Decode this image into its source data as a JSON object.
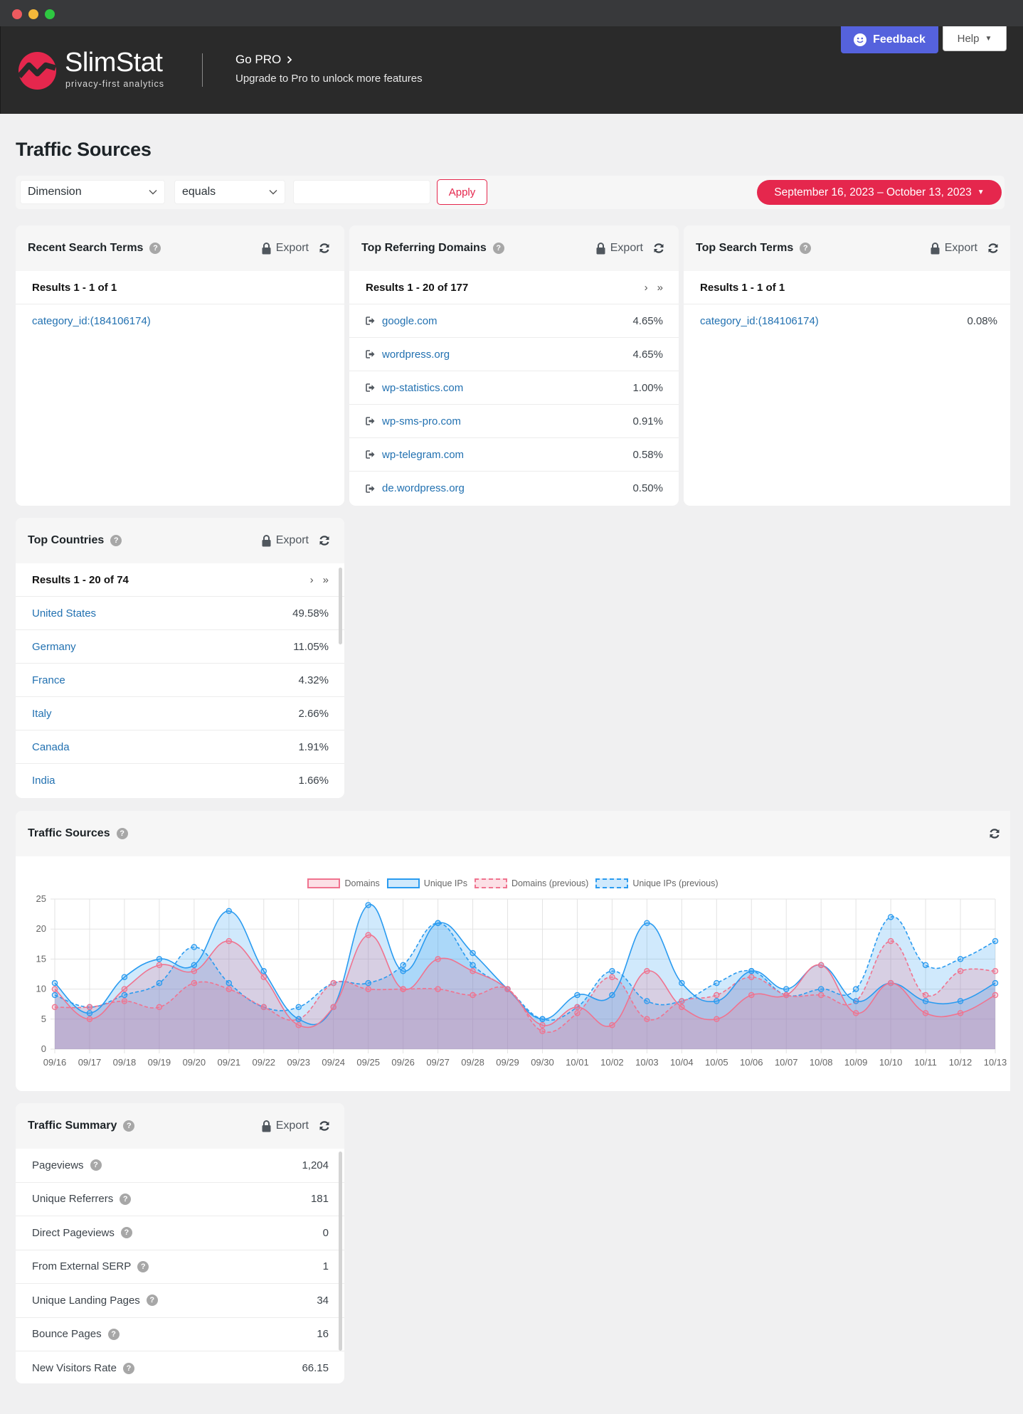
{
  "window": {
    "controls": [
      "close",
      "minimize",
      "maximize"
    ]
  },
  "header": {
    "logo_name": "SlimStat",
    "logo_tagline": "privacy-first analytics",
    "gopro_title": "Go PRO",
    "gopro_subtitle": "Upgrade to Pro to unlock more features",
    "feedback_label": "Feedback",
    "help_label": "Help"
  },
  "page": {
    "title": "Traffic Sources"
  },
  "filters": {
    "dimension": "Dimension",
    "operator": "equals",
    "value": "",
    "value_placeholder": "",
    "apply_label": "Apply",
    "date_range": "September 16, 2023 – October 13, 2023"
  },
  "common": {
    "export_label": "Export",
    "help_mark": "?",
    "next": "›",
    "last": "»"
  },
  "panels": {
    "recent_search": {
      "title": "Recent Search Terms",
      "results": "Results 1 - 1 of 1",
      "rows": [
        {
          "label": "category_id:(184106174)"
        }
      ]
    },
    "ref_domains": {
      "title": "Top Referring Domains",
      "results": "Results 1 - 20 of 177",
      "rows": [
        {
          "label": "google.com",
          "value": "4.65%"
        },
        {
          "label": "wordpress.org",
          "value": "4.65%"
        },
        {
          "label": "wp-statistics.com",
          "value": "1.00%"
        },
        {
          "label": "wp-sms-pro.com",
          "value": "0.91%"
        },
        {
          "label": "wp-telegram.com",
          "value": "0.58%"
        },
        {
          "label": "de.wordpress.org",
          "value": "0.50%"
        }
      ]
    },
    "top_search": {
      "title": "Top Search Terms",
      "results": "Results 1 - 1 of 1",
      "rows": [
        {
          "label": "category_id:(184106174)",
          "value": "0.08%"
        }
      ]
    },
    "countries": {
      "title": "Top Countries",
      "results": "Results 1 - 20 of 74",
      "rows": [
        {
          "label": "United States",
          "value": "49.58%"
        },
        {
          "label": "Germany",
          "value": "11.05%"
        },
        {
          "label": "France",
          "value": "4.32%"
        },
        {
          "label": "Italy",
          "value": "2.66%"
        },
        {
          "label": "Canada",
          "value": "1.91%"
        },
        {
          "label": "India",
          "value": "1.66%"
        }
      ]
    },
    "chart": {
      "title": "Traffic Sources"
    },
    "summary": {
      "title": "Traffic Summary",
      "rows": [
        {
          "label": "Pageviews",
          "value": "1,204"
        },
        {
          "label": "Unique Referrers",
          "value": "181"
        },
        {
          "label": "Direct Pageviews",
          "value": "0"
        },
        {
          "label": "From External SERP",
          "value": "1"
        },
        {
          "label": "Unique Landing Pages",
          "value": "34"
        },
        {
          "label": "Bounce Pages",
          "value": "16"
        },
        {
          "label": "New Visitors Rate",
          "value": "66.15"
        }
      ]
    }
  },
  "colors": {
    "brand": "#e5274d",
    "feedback": "#5562dd",
    "link": "#2271b1",
    "domains": "#f0738f",
    "unique_ips": "#2a9bf0"
  },
  "chart_data": {
    "type": "area",
    "title": "Traffic Sources",
    "xlabel": "",
    "ylabel": "",
    "ylim": [
      0,
      25
    ],
    "yticks": [
      0,
      5,
      10,
      15,
      20,
      25
    ],
    "grid": true,
    "legend": "top-center",
    "categories": [
      "09/16",
      "09/17",
      "09/18",
      "09/19",
      "09/20",
      "09/21",
      "09/22",
      "09/23",
      "09/24",
      "09/25",
      "09/26",
      "09/27",
      "09/28",
      "09/29",
      "09/30",
      "10/01",
      "10/02",
      "10/03",
      "10/04",
      "10/05",
      "10/06",
      "10/07",
      "10/08",
      "10/09",
      "10/10",
      "10/11",
      "10/12",
      "10/13"
    ],
    "series": [
      {
        "name": "Domains",
        "style": "solid",
        "color": "#f0738f",
        "values": [
          10,
          5,
          10,
          14,
          13,
          18,
          12,
          4,
          7,
          19,
          10,
          15,
          13,
          10,
          4,
          7,
          4,
          13,
          7,
          5,
          9,
          9,
          14,
          6,
          11,
          6,
          6,
          9
        ]
      },
      {
        "name": "Unique IPs",
        "style": "solid",
        "color": "#2a9bf0",
        "values": [
          11,
          6,
          12,
          15,
          14,
          23,
          13,
          5,
          7,
          24,
          13,
          21,
          16,
          10,
          5,
          9,
          9,
          21,
          11,
          8,
          13,
          10,
          14,
          8,
          11,
          8,
          8,
          11
        ]
      },
      {
        "name": "Domains (previous)",
        "style": "dashed",
        "color": "#f0738f",
        "values": [
          7,
          7,
          8,
          7,
          11,
          10,
          7,
          5,
          11,
          10,
          10,
          10,
          9,
          10,
          3,
          6,
          12,
          5,
          8,
          9,
          12,
          9,
          9,
          8,
          18,
          9,
          13,
          13
        ]
      },
      {
        "name": "Unique IPs (previous)",
        "style": "dashed",
        "color": "#2a9bf0",
        "values": [
          9,
          7,
          9,
          11,
          17,
          11,
          7,
          7,
          11,
          11,
          14,
          21,
          14,
          10,
          5,
          7,
          13,
          8,
          8,
          11,
          13,
          9,
          10,
          10,
          22,
          14,
          15,
          18
        ]
      }
    ]
  }
}
